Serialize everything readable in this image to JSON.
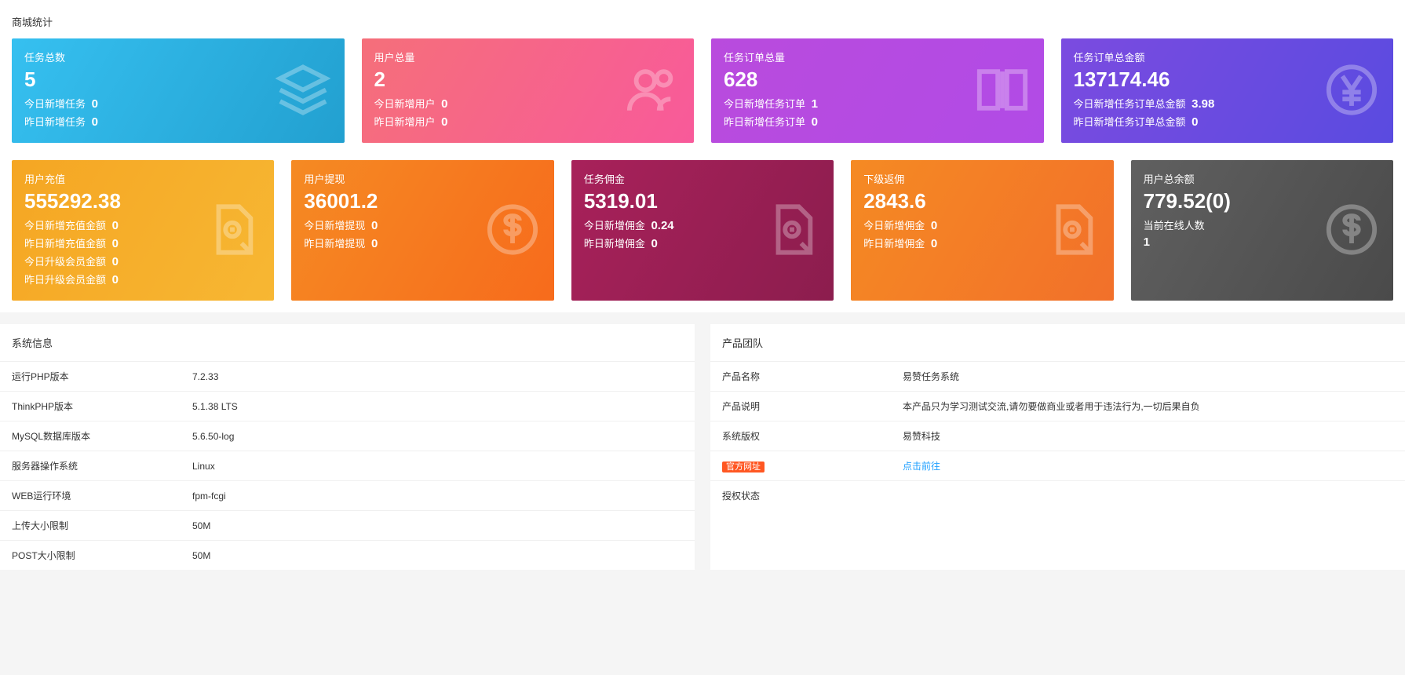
{
  "stats_title": "商城统计",
  "cards_row1": [
    {
      "title": "任务总数",
      "value": "5",
      "line1_label": "今日新增任务",
      "line1_val": "0",
      "line2_label": "昨日新增任务",
      "line2_val": "0",
      "icon": "layers"
    },
    {
      "title": "用户总量",
      "value": "2",
      "line1_label": "今日新增用户",
      "line1_val": "0",
      "line2_label": "昨日新增用户",
      "line2_val": "0",
      "icon": "users"
    },
    {
      "title": "任务订单总量",
      "value": "628",
      "line1_label": "今日新增任务订单",
      "line1_val": "1",
      "line2_label": "昨日新增任务订单",
      "line2_val": "0",
      "icon": "book"
    },
    {
      "title": "任务订单总金额",
      "value": "137174.46",
      "line1_label": "今日新增任务订单总金额",
      "line1_val": "3.98",
      "line2_label": "昨日新增任务订单总金额",
      "line2_val": "0",
      "icon": "yen"
    }
  ],
  "cards_row2": [
    {
      "title": "用户充值",
      "value": "555292.38",
      "lines": [
        {
          "label": "今日新增充值金额",
          "val": "0"
        },
        {
          "label": "昨日新增充值金额",
          "val": "0"
        },
        {
          "label": "今日升级会员金额",
          "val": "0"
        },
        {
          "label": "昨日升级会员金额",
          "val": "0"
        }
      ],
      "icon": "doc"
    },
    {
      "title": "用户提现",
      "value": "36001.2",
      "lines": [
        {
          "label": "今日新增提现",
          "val": "0"
        },
        {
          "label": "昨日新增提现",
          "val": "0"
        }
      ],
      "icon": "dollar"
    },
    {
      "title": "任务佣金",
      "value": "5319.01",
      "lines": [
        {
          "label": "今日新增佣金",
          "val": "0.24"
        },
        {
          "label": "昨日新增佣金",
          "val": "0"
        }
      ],
      "icon": "doc"
    },
    {
      "title": "下级返佣",
      "value": "2843.6",
      "lines": [
        {
          "label": "今日新增佣金",
          "val": "0"
        },
        {
          "label": "昨日新增佣金",
          "val": "0"
        }
      ],
      "icon": "doc"
    },
    {
      "title": "用户总余额",
      "value": "779.52(0)",
      "lines": [
        {
          "label": "当前在线人数",
          "val": ""
        },
        {
          "label": "1",
          "val": "",
          "bold": true
        }
      ],
      "icon": "dollar"
    }
  ],
  "sysinfo": {
    "title": "系统信息",
    "rows": [
      {
        "k": "运行PHP版本",
        "v": "7.2.33"
      },
      {
        "k": "ThinkPHP版本",
        "v": "5.1.38 LTS"
      },
      {
        "k": "MySQL数据库版本",
        "v": "5.6.50-log"
      },
      {
        "k": "服务器操作系统",
        "v": "Linux"
      },
      {
        "k": "WEB运行环境",
        "v": "fpm-fcgi"
      },
      {
        "k": "上传大小限制",
        "v": "50M"
      },
      {
        "k": "POST大小限制",
        "v": "50M"
      }
    ]
  },
  "product": {
    "title": "产品团队",
    "rows": [
      {
        "k": "产品名称",
        "v": "易赞任务系统"
      },
      {
        "k": "产品说明",
        "v": "本产品只为学习测试交流,请勿要做商业或者用于违法行为,一切后果自负"
      },
      {
        "k": "系统版权",
        "v": "易赞科技"
      },
      {
        "k": "官方网址",
        "v": "点击前往",
        "link": true,
        "badge": true
      },
      {
        "k": "授权状态",
        "v": ""
      }
    ]
  }
}
